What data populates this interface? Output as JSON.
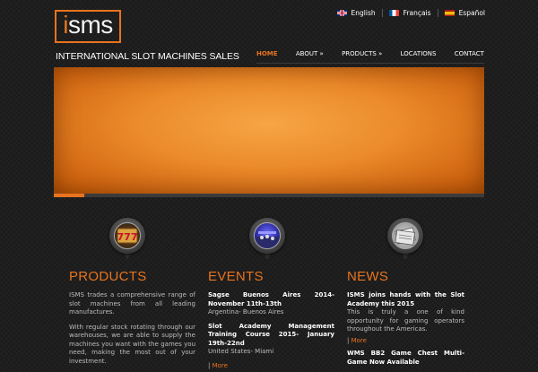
{
  "header": {
    "logo_text": "isms",
    "tagline": "INTERNATIONAL SLOT MACHINES SALES"
  },
  "languages": [
    {
      "label": "English",
      "flag": "uk-flag-icon"
    },
    {
      "label": "Français",
      "flag": "france-flag-icon"
    },
    {
      "label": "Español",
      "flag": "spain-flag-icon"
    }
  ],
  "nav": {
    "items": [
      {
        "label": "HOME",
        "active": true
      },
      {
        "label": "ABOUT »",
        "active": false
      },
      {
        "label": "PRODUCTS »",
        "active": false
      },
      {
        "label": "LOCATIONS",
        "active": false
      },
      {
        "label": "CONTACT",
        "active": false
      }
    ]
  },
  "slider": {
    "progress": 0.07
  },
  "sections": {
    "products": {
      "title": "PRODUCTS",
      "icon": "slot-reel-777-icon",
      "paragraphs": [
        "ISMS trades a comprehensive range of slot machines from all leading manufactures.",
        "With regular stock rotating through our warehouses, we are able to supply the machines you want with the games you need, making the most out of your investment."
      ]
    },
    "events": {
      "title": "EVENTS",
      "icon": "event-photo-icon",
      "items": [
        {
          "title": "Sagse Buenos Aires 2014- November 11th-13th",
          "location": "Argentina- Buenos Aires"
        },
        {
          "title": "Slot Academy Management Training Course 2015- January 19th-22nd",
          "location": "United States- Miami"
        }
      ],
      "more": "More"
    },
    "news": {
      "title": "NEWS",
      "icon": "newspaper-icon",
      "items": [
        {
          "title": "ISMS joins hands with the Slot Academy this 2015",
          "body": "This is truly a one of kind opportunity for gaming operators throughout the Americas."
        }
      ],
      "more": "More",
      "second_title": "WMS BB2 Game Chest Multi-Game Now Available"
    }
  },
  "colors": {
    "accent": "#e8741e",
    "background": "#1e1e1e",
    "text": "#bdbdbd"
  }
}
